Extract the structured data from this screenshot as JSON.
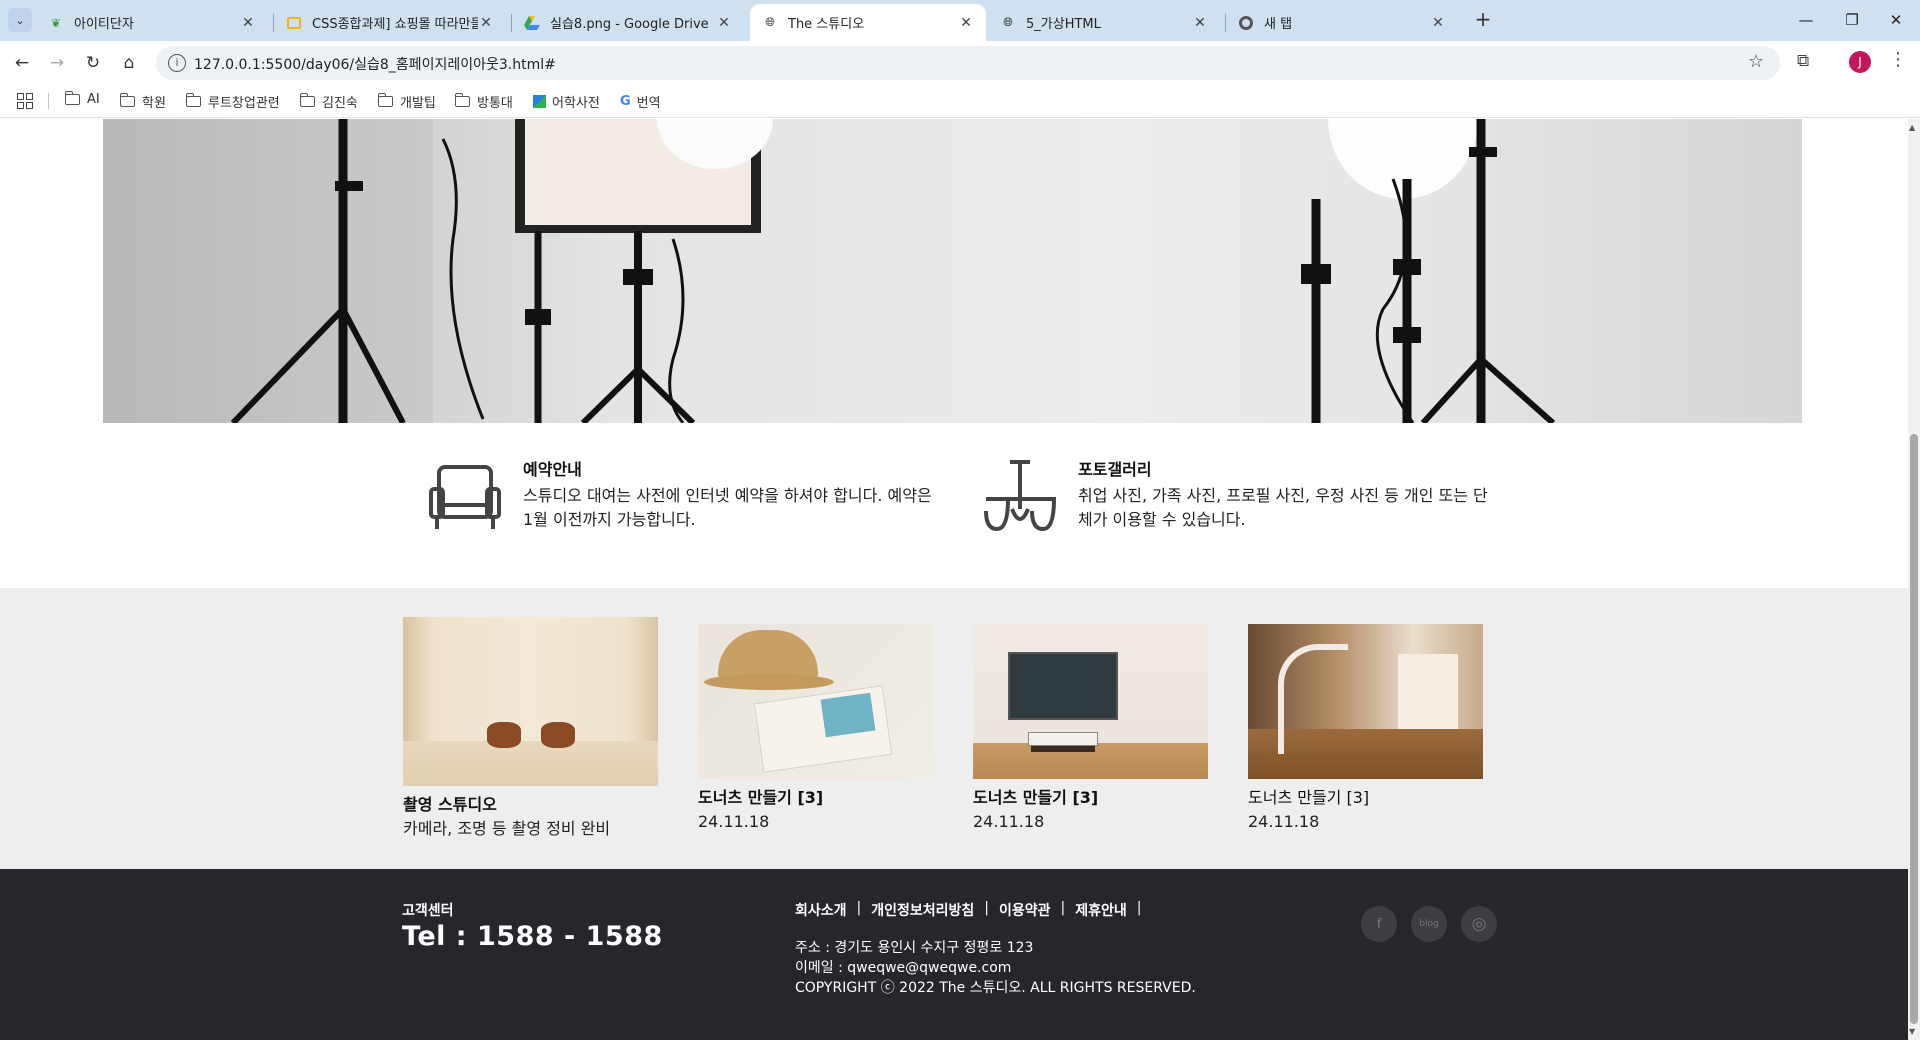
{
  "browser": {
    "tabs": [
      {
        "title": "아이티단자",
        "close": "✕"
      },
      {
        "title": "CSS종합과제] 쇼핑몰 따라만들",
        "close": "✕"
      },
      {
        "title": "실습8.png - Google Drive",
        "close": "✕"
      },
      {
        "title": "The 스튜디오",
        "close": "✕"
      },
      {
        "title": "5_가상HTML",
        "close": "✕"
      },
      {
        "title": "새 탭",
        "close": "✕"
      }
    ],
    "url": "127.0.0.1:5500/day06/실습8_홈페이지레이아웃3.html#",
    "profile_initial": "J",
    "bookmarks": [
      "AI",
      "학원",
      "루트창업관련",
      "김진숙",
      "개발팁",
      "방통대",
      "어학사전",
      "번역"
    ],
    "accent_color": "#cfe0f0"
  },
  "info": [
    {
      "title": "예약안내",
      "text": "스튜디오 대여는 사전에 인터넷 예약을 하셔야 합니다. 예약은 1월 이전까지 가능합니다.",
      "icon": "sofa-icon"
    },
    {
      "title": "포토갤러리",
      "text": "취업 사진, 가족 사진, 프로필 사진, 우정 사진 등 개인 또는 단체가 이용할 수 있습니다.",
      "icon": "chandelier-icon"
    }
  ],
  "gallery": [
    {
      "title": "촬영 스튜디오",
      "sub": "카메라, 조명 등 촬영 정비 완비"
    },
    {
      "title": "도너츠 만들기 [3]",
      "sub": "24.11.18"
    },
    {
      "title": "도너츠 만들기 [3]",
      "sub": "24.11.18"
    },
    {
      "title": "도너츠 만들기 [3]",
      "sub": "24.11.18"
    }
  ],
  "footer": {
    "cs_label": "고객센터",
    "tel": "Tel : 1588 - 1588",
    "nav": [
      "회사소개",
      "개인정보처리방침",
      "이용약관",
      "제휴안내"
    ],
    "nav_sep": "|",
    "address": "주소 : 경기도 용인시 수지구 정평로 123",
    "email": "이메일 : qweqwe@qweqwe.com",
    "copyright": "COPYRIGHT ⓒ 2022 The 스튜디오. ALL RIGHTS RESERVED.",
    "social": [
      "f",
      "blog",
      "◎"
    ]
  }
}
